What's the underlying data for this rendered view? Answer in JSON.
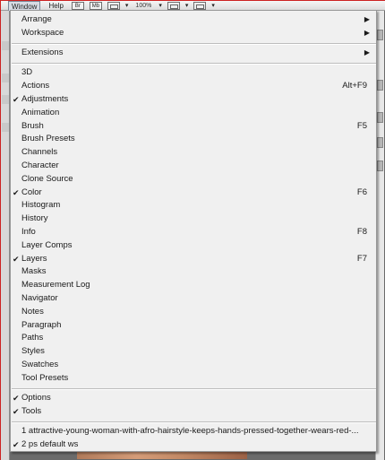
{
  "menubar": {
    "window_label": "Window",
    "help_label": "Help",
    "br_label": "Br",
    "mb_label": "Mb",
    "zoom_value": "100%"
  },
  "menu": {
    "sections": [
      [
        {
          "label": "Arrange",
          "shortcut": "",
          "checked": false,
          "submenu": true
        },
        {
          "label": "Workspace",
          "shortcut": "",
          "checked": false,
          "submenu": true
        }
      ],
      [
        {
          "label": "Extensions",
          "shortcut": "",
          "checked": false,
          "submenu": true
        }
      ],
      [
        {
          "label": "3D",
          "shortcut": "",
          "checked": false,
          "submenu": false
        },
        {
          "label": "Actions",
          "shortcut": "Alt+F9",
          "checked": false,
          "submenu": false
        },
        {
          "label": "Adjustments",
          "shortcut": "",
          "checked": true,
          "submenu": false
        },
        {
          "label": "Animation",
          "shortcut": "",
          "checked": false,
          "submenu": false
        },
        {
          "label": "Brush",
          "shortcut": "F5",
          "checked": false,
          "submenu": false
        },
        {
          "label": "Brush Presets",
          "shortcut": "",
          "checked": false,
          "submenu": false
        },
        {
          "label": "Channels",
          "shortcut": "",
          "checked": false,
          "submenu": false
        },
        {
          "label": "Character",
          "shortcut": "",
          "checked": false,
          "submenu": false
        },
        {
          "label": "Clone Source",
          "shortcut": "",
          "checked": false,
          "submenu": false
        },
        {
          "label": "Color",
          "shortcut": "F6",
          "checked": true,
          "submenu": false
        },
        {
          "label": "Histogram",
          "shortcut": "",
          "checked": false,
          "submenu": false
        },
        {
          "label": "History",
          "shortcut": "",
          "checked": false,
          "submenu": false
        },
        {
          "label": "Info",
          "shortcut": "F8",
          "checked": false,
          "submenu": false
        },
        {
          "label": "Layer Comps",
          "shortcut": "",
          "checked": false,
          "submenu": false
        },
        {
          "label": "Layers",
          "shortcut": "F7",
          "checked": true,
          "submenu": false
        },
        {
          "label": "Masks",
          "shortcut": "",
          "checked": false,
          "submenu": false
        },
        {
          "label": "Measurement Log",
          "shortcut": "",
          "checked": false,
          "submenu": false
        },
        {
          "label": "Navigator",
          "shortcut": "",
          "checked": false,
          "submenu": false
        },
        {
          "label": "Notes",
          "shortcut": "",
          "checked": false,
          "submenu": false
        },
        {
          "label": "Paragraph",
          "shortcut": "",
          "checked": false,
          "submenu": false
        },
        {
          "label": "Paths",
          "shortcut": "",
          "checked": false,
          "submenu": false
        },
        {
          "label": "Styles",
          "shortcut": "",
          "checked": false,
          "submenu": false
        },
        {
          "label": "Swatches",
          "shortcut": "",
          "checked": false,
          "submenu": false
        },
        {
          "label": "Tool Presets",
          "shortcut": "",
          "checked": false,
          "submenu": false
        }
      ],
      [
        {
          "label": "Options",
          "shortcut": "",
          "checked": true,
          "submenu": false
        },
        {
          "label": "Tools",
          "shortcut": "",
          "checked": true,
          "submenu": false
        }
      ],
      [
        {
          "label": "1 attractive-young-woman-with-afro-hairstyle-keeps-hands-pressed-together-wears-red-...",
          "shortcut": "",
          "checked": false,
          "submenu": false
        },
        {
          "label": "2 ps default ws",
          "shortcut": "",
          "checked": true,
          "submenu": false
        }
      ]
    ]
  },
  "ui": {
    "check_glyph": "✔",
    "arrow_glyph": "▶"
  }
}
